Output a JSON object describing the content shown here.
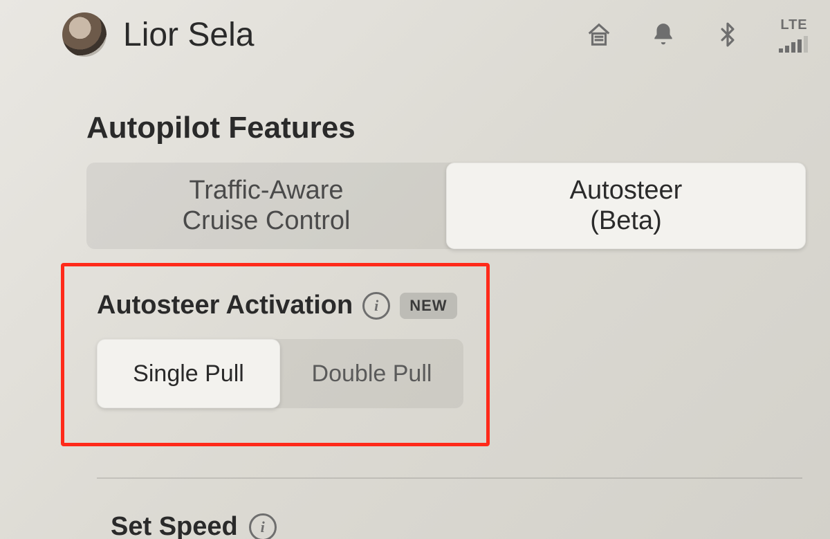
{
  "header": {
    "user_name": "Lior Sela",
    "network_label": "LTE"
  },
  "section": {
    "title": "Autopilot Features"
  },
  "mode_selector": {
    "option_a_line1": "Traffic-Aware",
    "option_a_line2": "Cruise Control",
    "option_b_line1": "Autosteer",
    "option_b_line2": "(Beta)",
    "selected": "b"
  },
  "activation": {
    "label": "Autosteer Activation",
    "badge": "NEW",
    "option_a": "Single Pull",
    "option_b": "Double Pull",
    "selected": "a"
  },
  "set_speed": {
    "label": "Set Speed"
  }
}
